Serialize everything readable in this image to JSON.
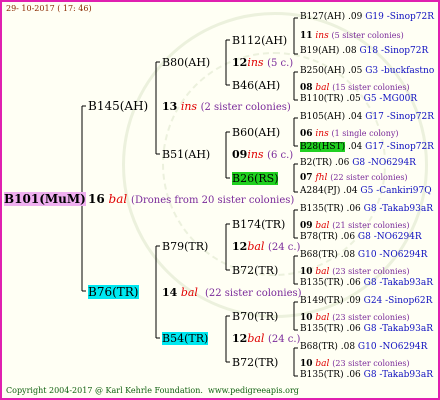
{
  "header": {
    "date": "29- 10-2017 ( 17: 46)"
  },
  "footer": {
    "copyright": "Copyright 2004-2017 @ Karl Kehrle Foundation.",
    "url": "www.pedigreeapis.org"
  },
  "root": {
    "name": "B101(MuM)",
    "gen": "16",
    "race": "bal",
    "note": "(Drones from 20 sister colonies)"
  },
  "gen1": {
    "a": {
      "name": "B145(AH)",
      "gen": "13",
      "race": "ins",
      "note": "(2 sister colonies)"
    },
    "b": {
      "name": "B76(TR)",
      "gen": "14",
      "race": "bal",
      "note": "(22 sister colonies)"
    }
  },
  "gen2": {
    "aa": {
      "name": "B80(AH)",
      "gen": "",
      "race": "",
      "note": ""
    },
    "ab": {
      "name": "B51(AH)",
      "gen": "09",
      "race": "ins",
      "note": "(6 c.)"
    },
    "ba": {
      "name": "B79(TR)",
      "gen": "12",
      "race": "bal",
      "note": "(24 c.)"
    },
    "bb": {
      "name": "B54(TR)",
      "gen": "12",
      "race": "bal",
      "note": "(24 c.)"
    }
  },
  "gen3": {
    "aaa": {
      "name": "B112(AH)",
      "gen": "12",
      "race": "ins",
      "note": "(5 c.)"
    },
    "aab": {
      "name": "B46(AH)"
    },
    "aba": {
      "name": "B60(AH)"
    },
    "abb": {
      "name": "B26(RS)"
    },
    "baa": {
      "name": "B174(TR)"
    },
    "bab": {
      "name": "B72(TR)"
    },
    "bba": {
      "name": "B70(TR)"
    },
    "bbb": {
      "name": "B72(TR)"
    }
  },
  "right": [
    {
      "a": "B127(AH)",
      "b": ".09",
      "c": "G19 -Sinop72R"
    },
    {
      "a": "11",
      "r": "ins",
      "n": "(5 sister colonies)"
    },
    {
      "a": "B19(AH)",
      "b": ".08",
      "c": "G18 -Sinop72R"
    },
    {
      "a": "B250(AH)",
      "b": ".05",
      "c": "G3 -buckfastno"
    },
    {
      "a": "08",
      "r": "bal",
      "n": "(15 sister colonies)"
    },
    {
      "a": "B110(TR)",
      "b": ".05",
      "c": "G5 -MG00R"
    },
    {
      "a": "B105(AH)",
      "b": ".04",
      "c": "G17 -Sinop72R"
    },
    {
      "a": "06",
      "r": "ins",
      "n": "(1 single colony)"
    },
    {
      "a": "B28(HST)",
      "b": ".04",
      "c": "G17 -Sinop72R"
    },
    {
      "a": "B2(TR)",
      "b": ".06",
      "c": "G8 -NO6294R"
    },
    {
      "a": "07",
      "r": "fhl",
      "n": "(22 sister colonies)"
    },
    {
      "a": "A284(PJ)",
      "b": ".04",
      "c": "G5 -Cankiri97Q"
    },
    {
      "a": "B135(TR)",
      "b": ".06",
      "c": "G8 -Takab93aR"
    },
    {
      "a": "09",
      "r": "bal",
      "n": "(21 sister colonies)"
    },
    {
      "a": "B78(TR)",
      "b": ".06",
      "c": "G8 -NO6294R"
    },
    {
      "a": "B68(TR)",
      "b": ".08",
      "c": "G10 -NO6294R"
    },
    {
      "a": "10",
      "r": "bal",
      "n": "(23 sister colonies)"
    },
    {
      "a": "B135(TR)",
      "b": ".06",
      "c": "G8 -Takab93aR"
    },
    {
      "a": "B149(TR)",
      "b": ".09",
      "c": "G24 -Sinop62R"
    },
    {
      "a": "10",
      "r": "bal",
      "n": "(23 sister colonies)"
    },
    {
      "a": "B135(TR)",
      "b": ".06",
      "c": "G8 -Takab93aR"
    },
    {
      "a": "B68(TR)",
      "b": ".08",
      "c": "G10 -NO6294R"
    },
    {
      "a": "10",
      "r": "bal",
      "n": "(23 sister colonies)"
    },
    {
      "a": "B135(TR)",
      "b": ".06",
      "c": "G8 -Takab93aR"
    }
  ]
}
